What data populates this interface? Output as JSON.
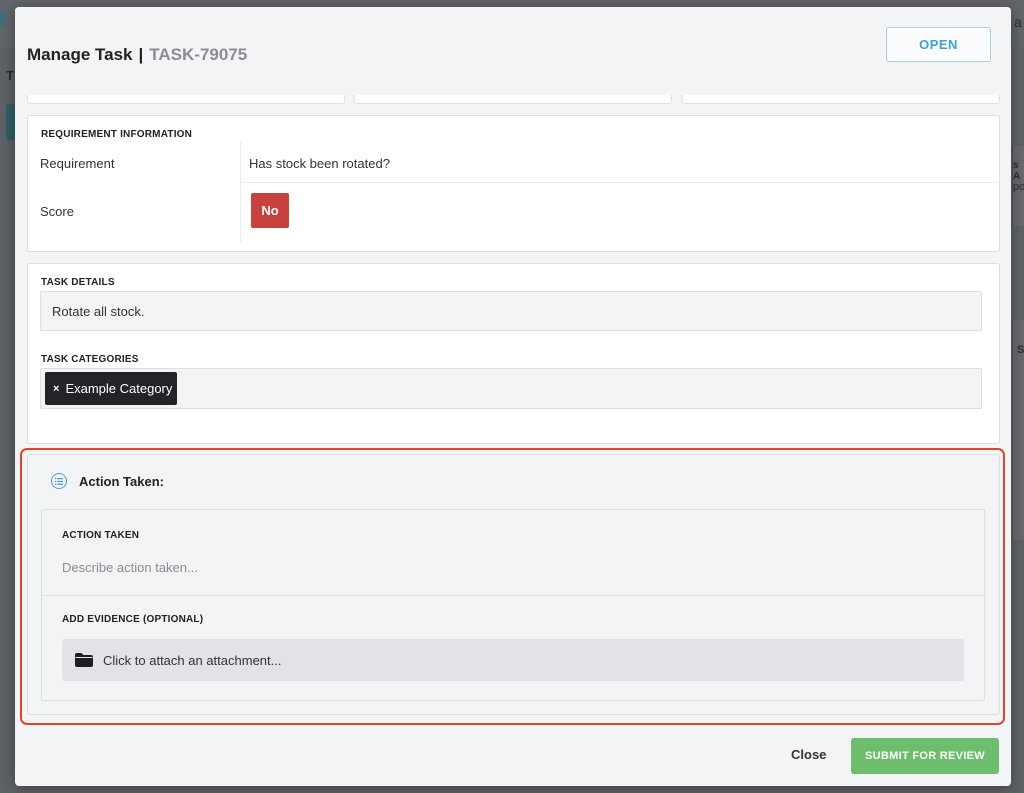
{
  "background": {
    "tab_fragment": "T",
    "right_fragment_1": "a",
    "right_fragment_2": "s A",
    "right_fragment_3": "po",
    "right_fragment_4": "S"
  },
  "modal": {
    "title": "Manage Task",
    "title_separator": "|",
    "task_id": "TASK-79075",
    "status_label": "OPEN"
  },
  "requirement": {
    "section_label": "REQUIREMENT INFORMATION",
    "requirement_key": "Requirement",
    "requirement_value": "Has stock been rotated?",
    "score_key": "Score",
    "score_value": "No"
  },
  "task": {
    "details_label": "TASK DETAILS",
    "details_value": "Rotate all stock.",
    "categories_label": "TASK CATEGORIES",
    "categories": [
      {
        "label": "Example Category",
        "remove_glyph": "×"
      }
    ]
  },
  "action": {
    "title": "Action Taken:",
    "field_label": "ACTION TAKEN",
    "field_placeholder": "Describe action taken...",
    "evidence_label": "ADD EVIDENCE (OPTIONAL)",
    "attach_label": "Click to attach an attachment..."
  },
  "footer": {
    "close_label": "Close",
    "submit_label": "SUBMIT FOR REVIEW"
  },
  "colors": {
    "status_blue": "#3fa1cf",
    "score_red": "#c8413d",
    "highlight_orange": "#e0462a",
    "submit_green": "#6dbd6d"
  },
  "icons": [
    "list-icon",
    "folder-icon",
    "close-x-icon"
  ]
}
